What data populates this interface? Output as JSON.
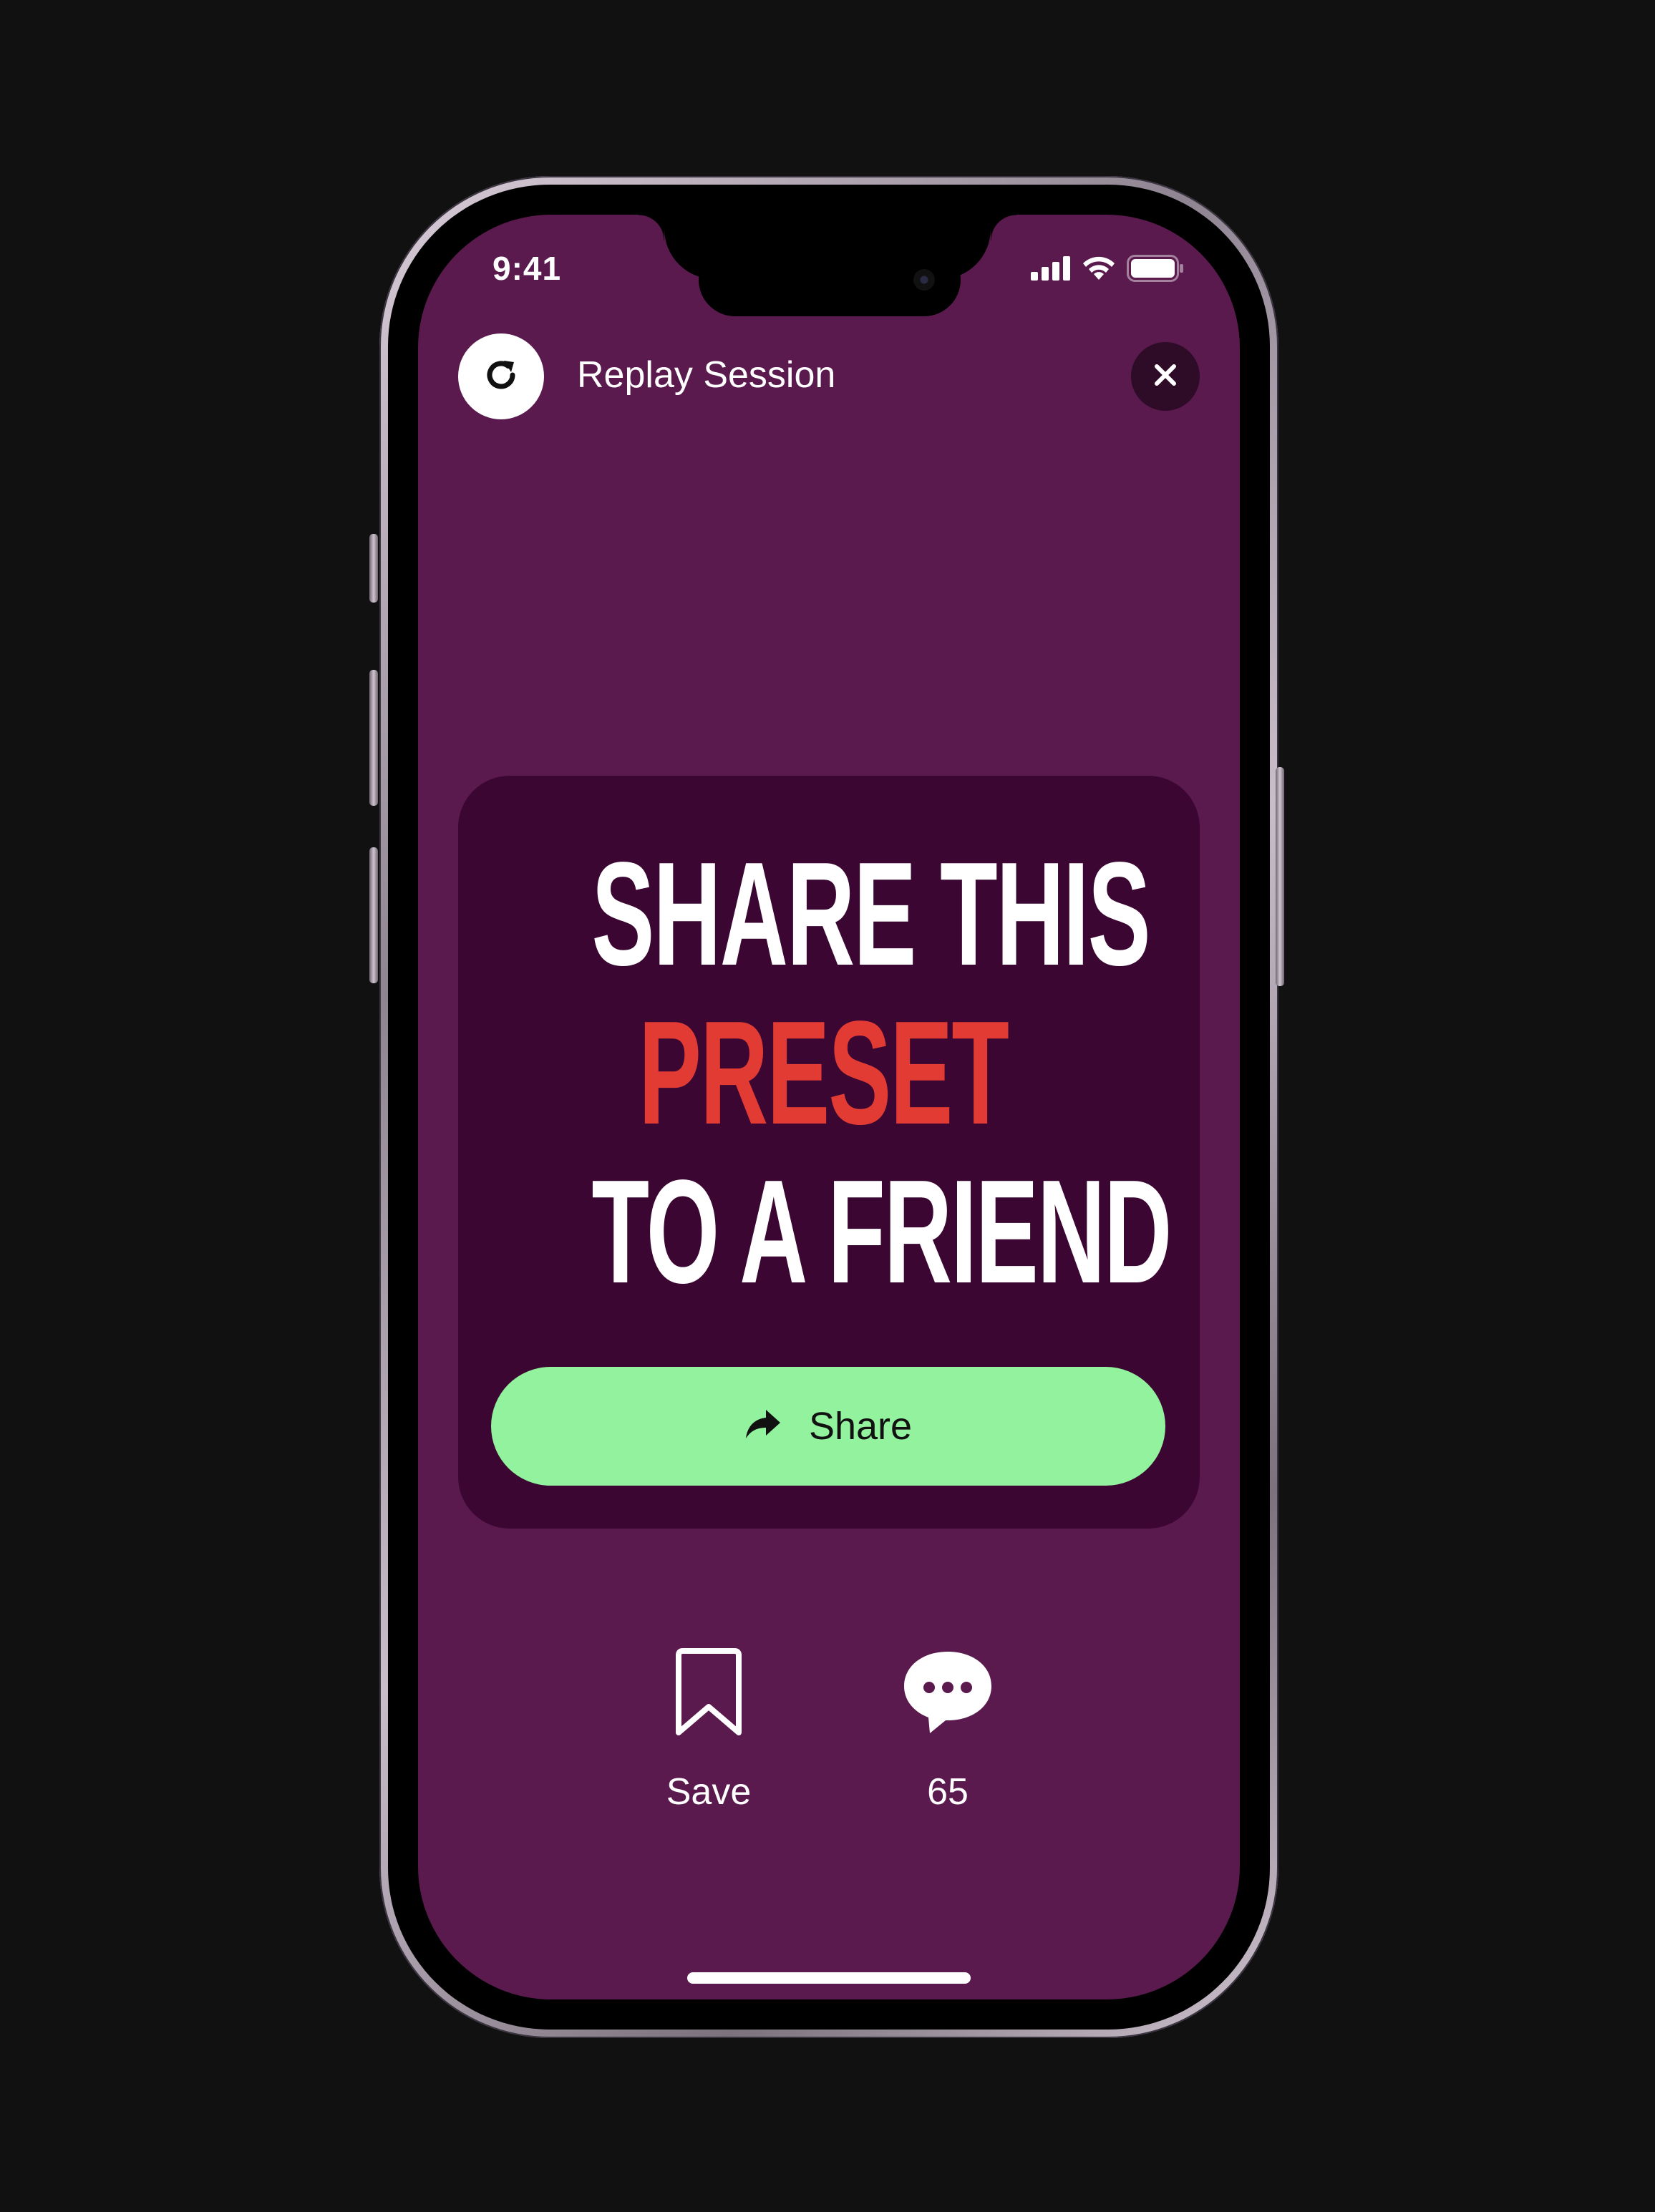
{
  "status_bar": {
    "time": "9:41",
    "icons": [
      "cellular-signal-icon",
      "wifi-icon",
      "battery-icon"
    ]
  },
  "header": {
    "replay_icon": "refresh-icon",
    "title": "Replay Session",
    "close_icon": "close-icon"
  },
  "card": {
    "headline": {
      "line1": "SHARE THIS",
      "line2": "PRESET",
      "line3": "TO A FRIEND"
    },
    "share_button": {
      "icon": "share-arrow-icon",
      "label": "Share"
    }
  },
  "actions": {
    "save": {
      "icon": "bookmark-icon",
      "label": "Save"
    },
    "comments": {
      "icon": "chat-bubble-icon",
      "label": "65"
    }
  },
  "colors": {
    "page_background": "#111111",
    "screen_background": "#5a1a4e",
    "card_background": "#3c0632",
    "accent_red": "#e23b33",
    "share_button": "#92f29d",
    "close_button": "#2e0c28"
  }
}
